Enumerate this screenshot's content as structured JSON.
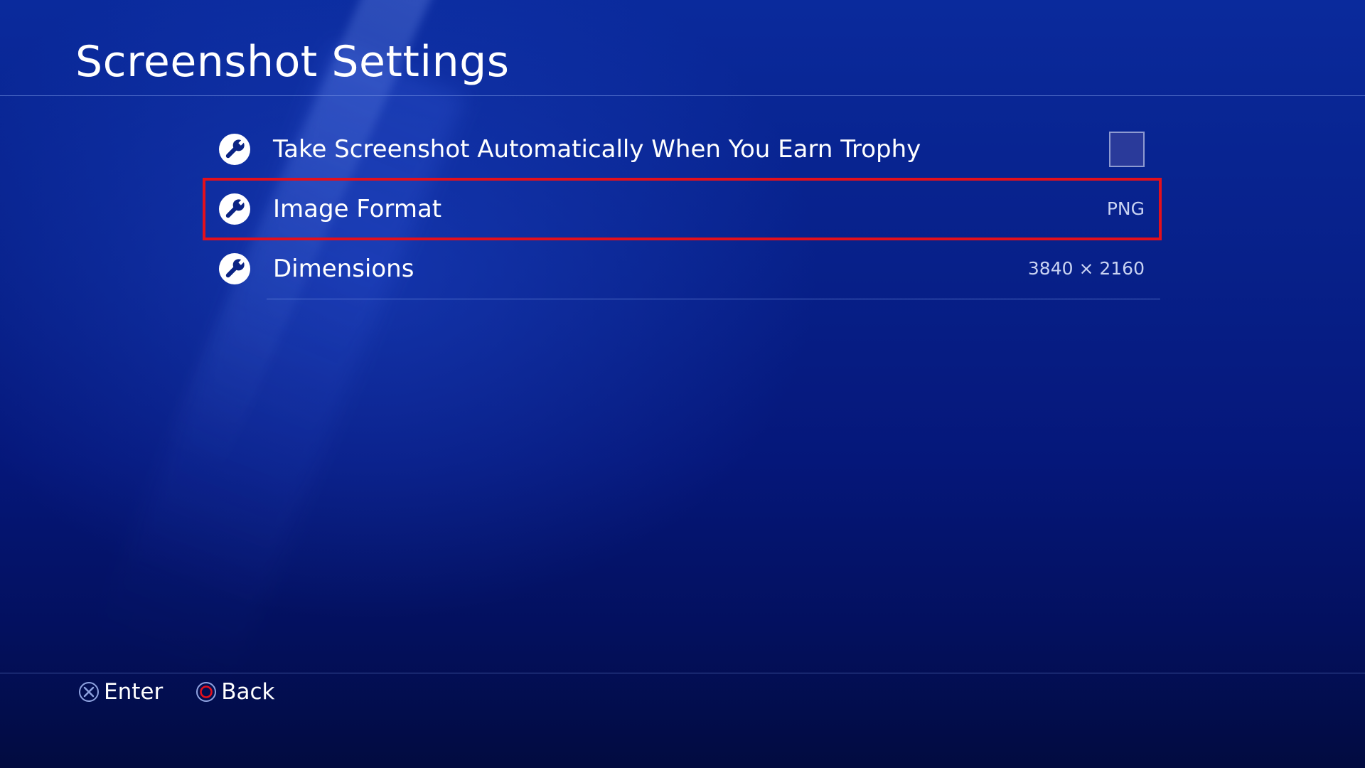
{
  "page": {
    "title": "Screenshot Settings"
  },
  "settings": [
    {
      "label": "Take Screenshot Automatically When You Earn Trophy",
      "control": "checkbox",
      "checked": false,
      "icon": "wrench-icon"
    },
    {
      "label": "Image Format",
      "control": "value",
      "value": "PNG",
      "selected": true,
      "icon": "wrench-icon"
    },
    {
      "label": "Dimensions",
      "control": "value",
      "value": "3840 × 2160",
      "icon": "wrench-icon"
    }
  ],
  "footer": {
    "enter_label": "Enter",
    "enter_icon": "cross-button-icon",
    "back_label": "Back",
    "back_icon": "circle-button-icon"
  },
  "colors": {
    "selection_outline": "#e3101c",
    "background_top": "#0a2a9c",
    "background_bottom": "#020b40",
    "circle_button": "#e3101c",
    "cross_button": "#8fa3e0"
  }
}
